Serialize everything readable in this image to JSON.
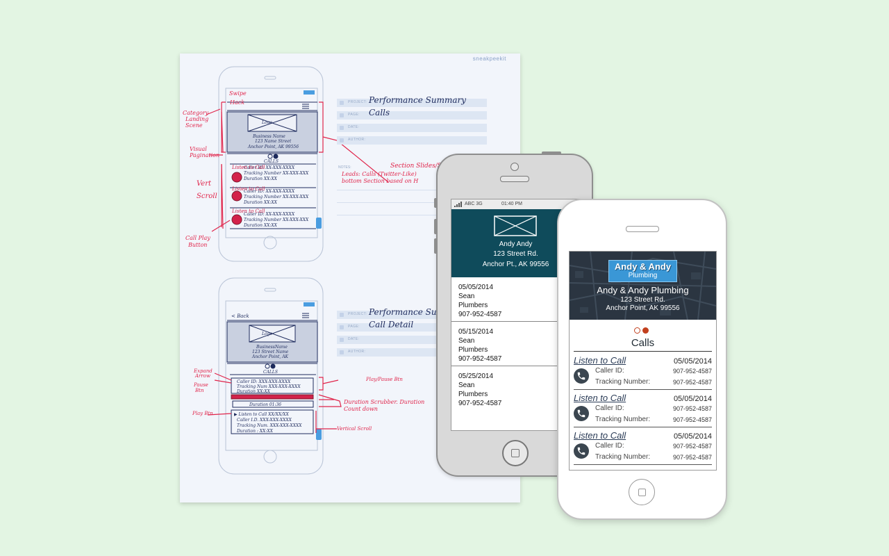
{
  "sketch": {
    "brand": "sneakpeekit",
    "sheet1": {
      "project_label": "PROJECT:",
      "project_value": "Performance Summary",
      "page_label": "PAGE:",
      "page_value": "Calls",
      "date_label": "DATE:",
      "author_label": "AUTHOR:",
      "notes_label": "NOTES:"
    },
    "sheet2": {
      "project_label": "PROJECT:",
      "project_value": "Performance Summary",
      "page_label": "PAGE:",
      "page_value": "Call Detail",
      "date_label": "DATE:",
      "author_label": "AUTHOR:"
    },
    "annotations1": [
      "Swipe",
      "Category Landing Scene",
      "Visual Pagination",
      "Vert Scroll",
      "Call Play Button",
      "Section Slides/Swipe",
      "Leads: Calls (Twitter-Like)",
      "bottom Section based on H"
    ],
    "annotations2": [
      "Expand Arrow",
      "Pause Btn",
      "Play Btn",
      "Play/Pause Btn",
      "Duration Scrubber. Duration",
      "Count down",
      "Vertical Scroll"
    ],
    "wire1": {
      "logo": "Logo",
      "business_name": "Business Name",
      "street": "123 Name Street",
      "city": "Anchor Point, AK 99556",
      "calls": "CALLS",
      "listen": "Listen to Call",
      "caller": "Caller ID:",
      "tracking": "Tracking Number:",
      "duration": "Duration"
    },
    "wire2": {
      "back": "< Back",
      "logo": "Logo",
      "business_name": "BusinessName",
      "street": "123 Street Name",
      "city": "Anchor Point, AK",
      "calls": "CALLS",
      "duration": "Duration 01:36",
      "listen": "Listen to Call",
      "caller": "Caller I.D.",
      "tracking": "Tracking Num.",
      "duration2": "Duration"
    }
  },
  "phone1": {
    "status": {
      "carrier": "ABC 3G",
      "time": "01:40 PM"
    },
    "header": {
      "name": "Andy Andy",
      "street": "123 Street Rd.",
      "city": "Anchor Pt., AK 99556"
    },
    "calls": [
      {
        "date": "05/05/2014",
        "name": "Sean",
        "category": "Plumbers",
        "phone": "907-952-4587"
      },
      {
        "date": "05/15/2014",
        "name": "Sean",
        "category": "Plumbers",
        "phone": "907-952-4587"
      },
      {
        "date": "05/25/2014",
        "name": "Sean",
        "category": "Plumbers",
        "phone": "907-952-4587"
      }
    ]
  },
  "phone2": {
    "logo": {
      "line1": "Andy & Andy",
      "line2": "Plumbing"
    },
    "header": {
      "name": "Andy & Andy Plumbing",
      "street": "123 Street Rd.",
      "city": "Anchor Point, AK 99556"
    },
    "section_title": "Calls",
    "calls": [
      {
        "link": "Listen to Call",
        "date": "05/05/2014",
        "caller_label": "Caller ID:",
        "caller_value": "907-952-4587",
        "tracking_label": "Tracking Number:",
        "tracking_value": "907-952-4587"
      },
      {
        "link": "Listen to Call",
        "date": "05/05/2014",
        "caller_label": "Caller ID:",
        "caller_value": "907-952-4587",
        "tracking_label": "Tracking Number:",
        "tracking_value": "907-952-4587"
      },
      {
        "link": "Listen to Call",
        "date": "05/05/2014",
        "caller_label": "Caller ID:",
        "caller_value": "907-952-4587",
        "tracking_label": "Tracking Number:",
        "tracking_value": "907-952-4587"
      }
    ]
  },
  "colors": {
    "background": "#e3f5e3",
    "teal_header": "#0f4b5b",
    "sketch_red": "#e0244a",
    "sketch_ink": "#1d2a5c",
    "active_dot": "#c2401e"
  }
}
